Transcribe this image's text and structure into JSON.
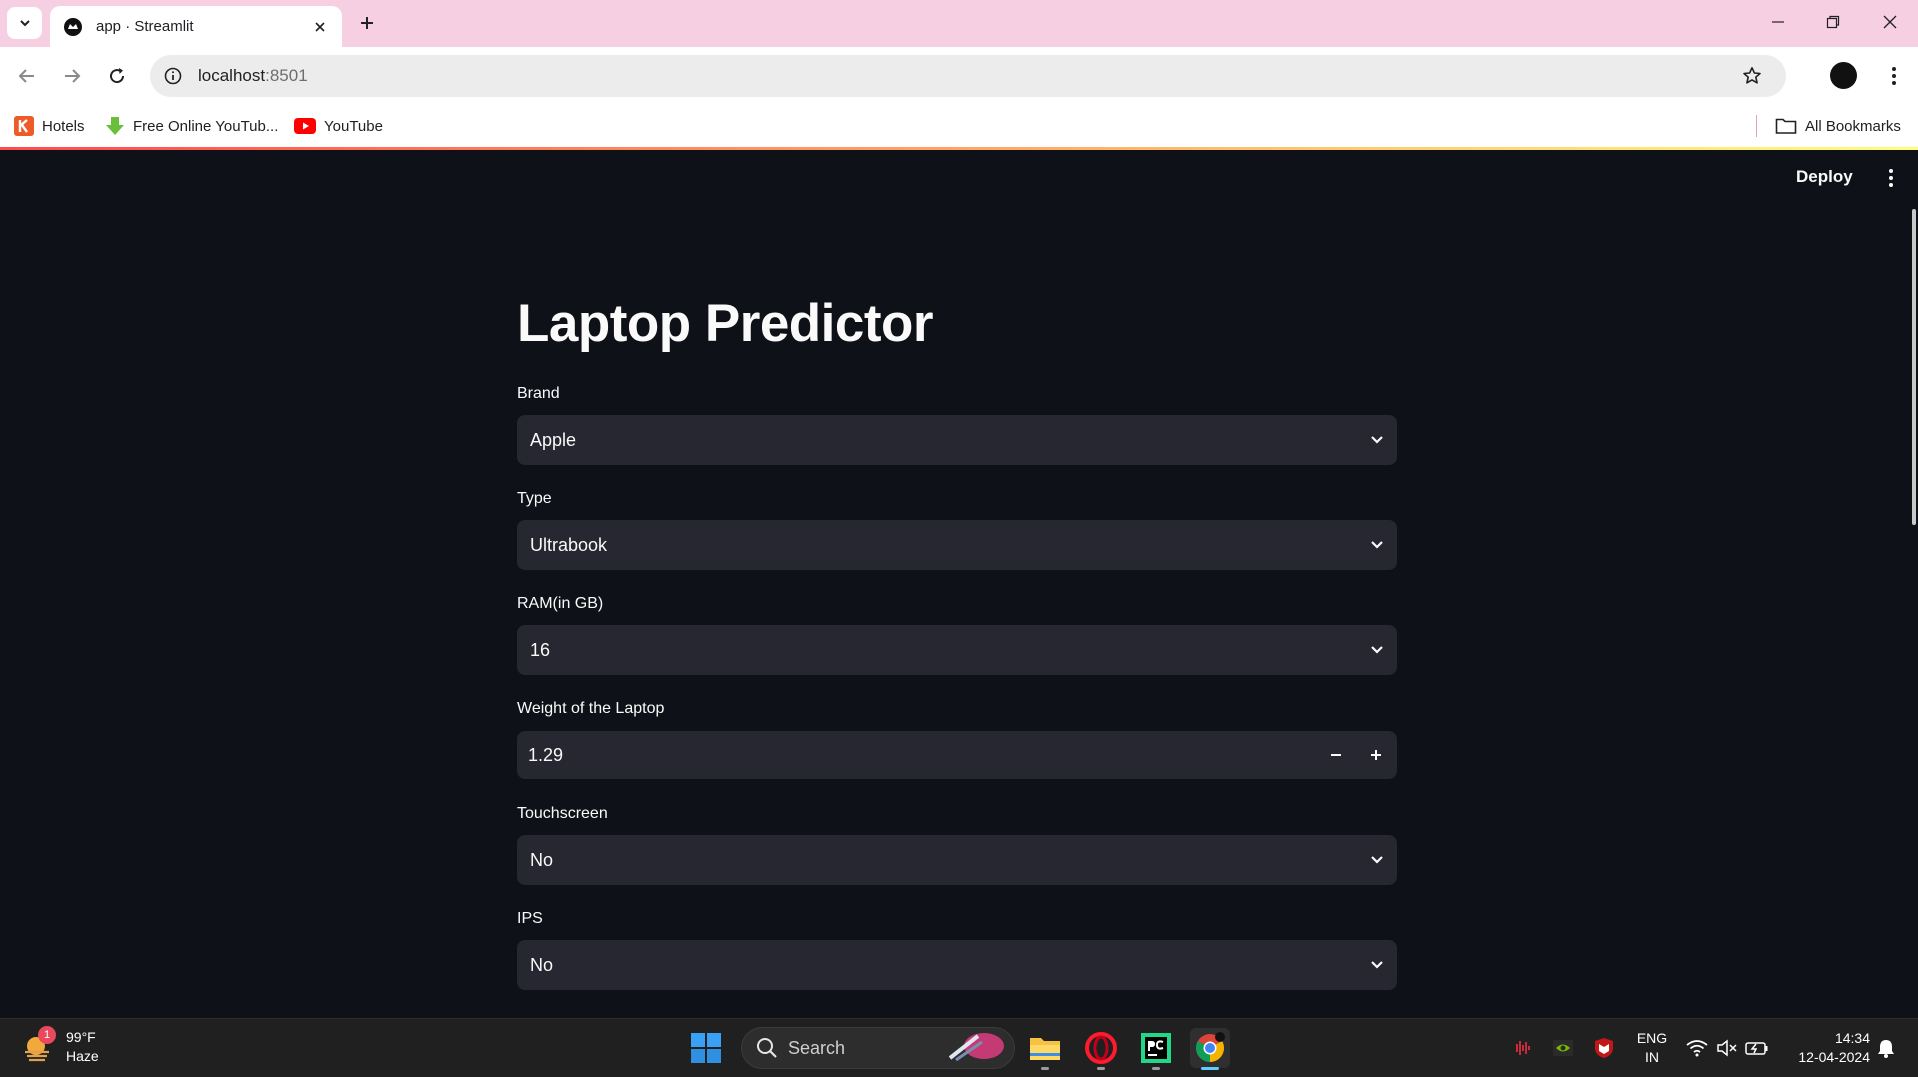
{
  "browser": {
    "tab_title": "app · Streamlit",
    "url_host": "localhost",
    "url_port": ":8501",
    "bookmarks": [
      {
        "label": "Hotels"
      },
      {
        "label": "Free Online YouTub..."
      },
      {
        "label": "YouTube"
      }
    ],
    "all_bookmarks_label": "All Bookmarks"
  },
  "app": {
    "deploy_label": "Deploy",
    "title": "Laptop Predictor",
    "fields": {
      "brand": {
        "label": "Brand",
        "value": "Apple"
      },
      "type": {
        "label": "Type",
        "value": "Ultrabook"
      },
      "ram": {
        "label": "RAM(in GB)",
        "value": "16"
      },
      "weight": {
        "label": "Weight of the Laptop",
        "value": "1.29"
      },
      "touchscreen": {
        "label": "Touchscreen",
        "value": "No"
      },
      "ips": {
        "label": "IPS",
        "value": "No"
      }
    },
    "colors": {
      "background": "#0e1117",
      "widget": "#262730",
      "text": "#fafafa"
    }
  },
  "taskbar": {
    "weather_temp": "99°F",
    "weather_desc": "Haze",
    "weather_badge": "1",
    "search_label": "Search",
    "lang_line1": "ENG",
    "lang_line2": "IN",
    "time": "14:34",
    "date": "12-04-2024"
  }
}
